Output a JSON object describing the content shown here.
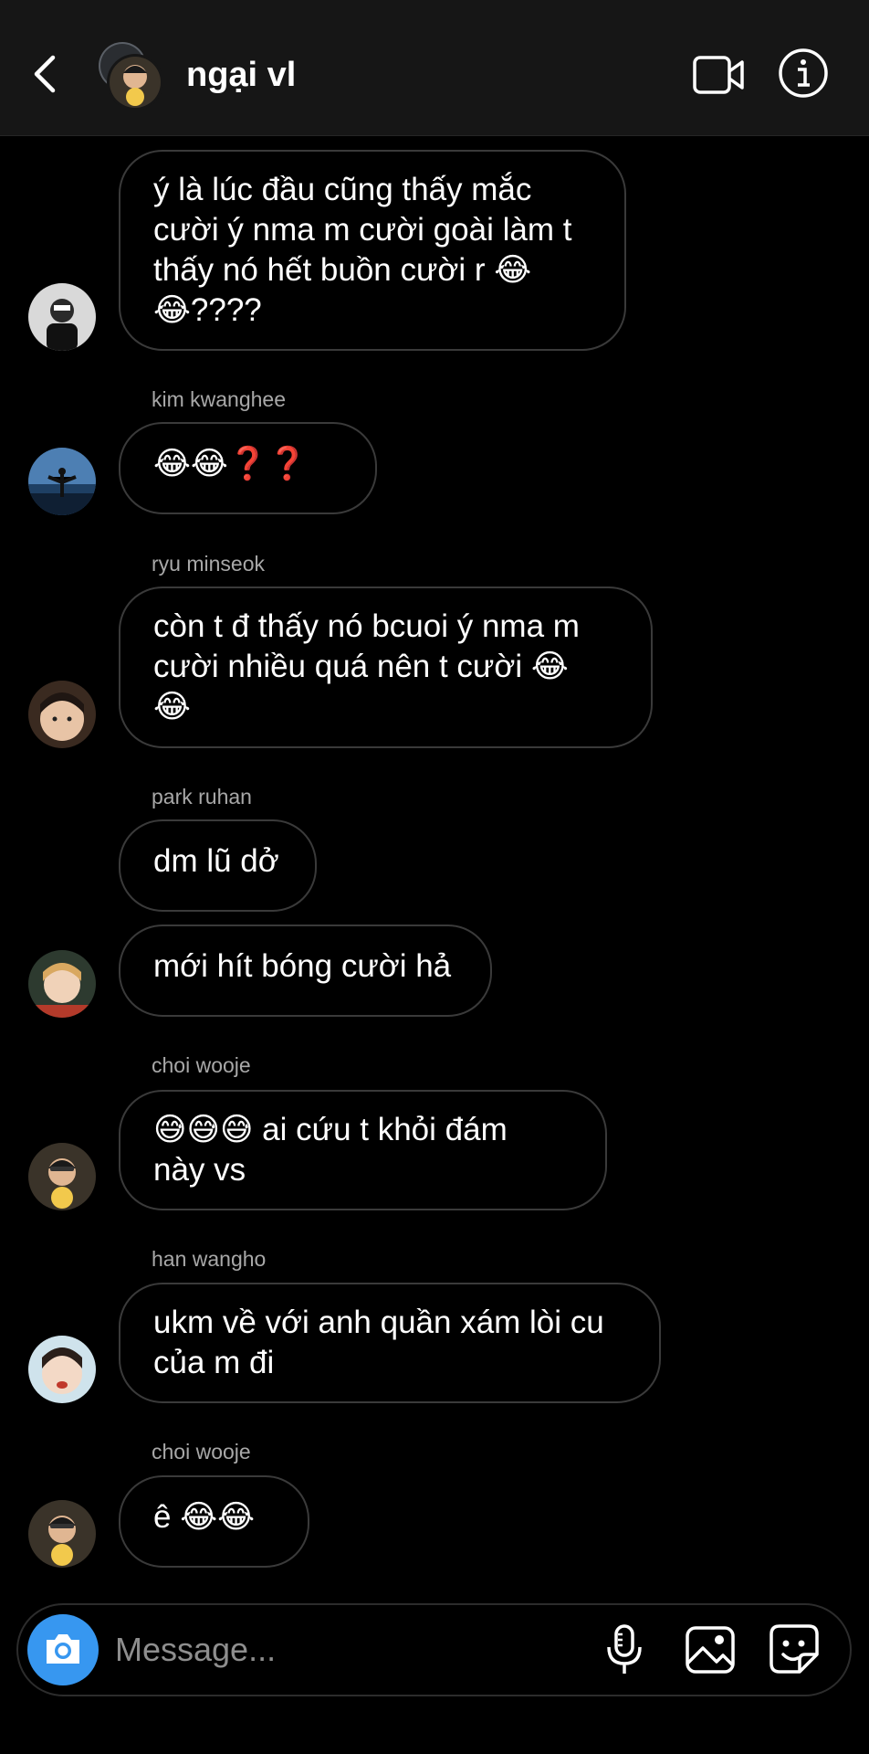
{
  "header": {
    "title": "ngại vl",
    "icons": [
      "back-arrow-icon",
      "video-call-icon",
      "info-icon"
    ]
  },
  "messages": [
    {
      "sender": "",
      "text": "ý là lúc đầu cũng thấy mắc\ncười ý nma m cười goài làm t\nthấy nó hết buồn cười r 😂\n😂????"
    },
    {
      "sender": "kim kwanghee",
      "text": "😂😂❓❓"
    },
    {
      "sender": "ryu minseok",
      "text": "còn t đ thấy nó bcuoi ý nma m\ncười nhiều quá nên t cười 😂\n😂"
    },
    {
      "sender": "park ruhan",
      "text": "dm lũ dở"
    },
    {
      "sender": "",
      "text": "mới hít bóng cười hả"
    },
    {
      "sender": "choi wooje",
      "text": "😅😅😅 ai cứu t khỏi đám\nnày vs"
    },
    {
      "sender": "han wangho",
      "text": "ukm về với anh quần xám lòi cu\ncủa m đi"
    },
    {
      "sender": "choi wooje",
      "text": "ê 😂😂"
    }
  ],
  "composer": {
    "placeholder": "Message...",
    "icons": [
      "camera-icon",
      "microphone-icon",
      "gallery-icon",
      "sticker-icon"
    ]
  },
  "colors": {
    "accent": "#3797f0",
    "bubble_border": "#3a3a3a",
    "header_bg": "#161616"
  }
}
